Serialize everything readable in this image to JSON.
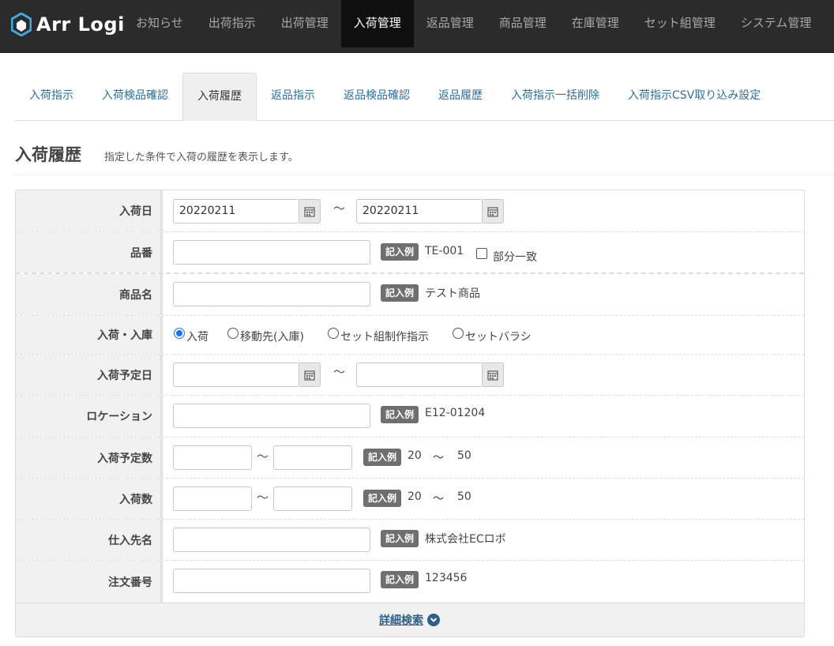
{
  "header": {
    "logo_text": "Arr Logi",
    "nav": [
      "お知らせ",
      "出荷指示",
      "出荷管理",
      "入荷管理",
      "返品管理",
      "商品管理",
      "在庫管理",
      "セット組管理",
      "システム管理"
    ],
    "active_nav": "入荷管理"
  },
  "subtabs": {
    "items": [
      "入荷指示",
      "入荷検品確認",
      "入荷履歴",
      "返品指示",
      "返品検品確認",
      "返品履歴",
      "入荷指示一括削除",
      "入荷指示CSV取り込み設定"
    ],
    "active": "入荷履歴"
  },
  "page": {
    "title": "入荷履歴",
    "description": "指定した条件で入荷の履歴を表示します。"
  },
  "form": {
    "example_badge": "記入例",
    "tilde": "～",
    "arrival_date": {
      "label": "入荷日",
      "from": "20220211",
      "to": "20220211"
    },
    "item_code": {
      "label": "品番",
      "example": "TE-001",
      "partial_label": "部分一致"
    },
    "product_name": {
      "label": "商品名",
      "example": "テスト商品"
    },
    "in_type": {
      "label": "入荷・入庫",
      "options": [
        "入荷",
        "移動先(入庫)",
        "セット組制作指示",
        "セットバラシ"
      ],
      "selected": "入荷"
    },
    "planned_date": {
      "label": "入荷予定日",
      "from": "",
      "to": ""
    },
    "location": {
      "label": "ロケーション",
      "example": "E12-01204"
    },
    "planned_qty": {
      "label": "入荷予定数",
      "example_from": "20",
      "example_to": "50"
    },
    "arrival_qty": {
      "label": "入荷数",
      "example_from": "20",
      "example_to": "50"
    },
    "supplier": {
      "label": "仕入先名",
      "example": "株式会社ECロボ"
    },
    "order_no": {
      "label": "注文番号",
      "example": "123456"
    },
    "detail_search": "詳細検索"
  },
  "colors": {
    "topbar": "#2b2b2b",
    "link": "#2d6ea3",
    "badge": "#6f6f6f",
    "radio_accent": "#1a73e8"
  }
}
